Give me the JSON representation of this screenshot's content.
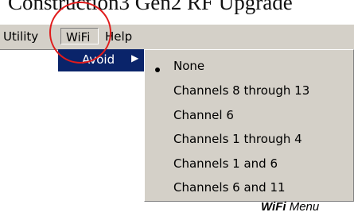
{
  "document": {
    "title": "Construction3 Gen2 RF Upgrade",
    "caption_bold": "WiFi",
    "caption_rest": " Menu"
  },
  "menubar": {
    "items": [
      {
        "label": "Utility"
      },
      {
        "label": "WiFi"
      },
      {
        "label": "Help"
      }
    ]
  },
  "submenu": {
    "label": "Avoid",
    "arrow": "▶"
  },
  "popup": {
    "selected_marker": "•",
    "options": [
      {
        "label": "None",
        "selected": true
      },
      {
        "label": "Channels 8 through 13",
        "selected": false
      },
      {
        "label": "Channel 6",
        "selected": false
      },
      {
        "label": "Channels 1 through 4",
        "selected": false
      },
      {
        "label": "Channels 1 and 6",
        "selected": false
      },
      {
        "label": "Channels 6 and 11",
        "selected": false
      }
    ]
  },
  "colors": {
    "menu_bg": "#d4d0c8",
    "highlight_bg": "#0a246a",
    "annotation": "#e01b1b"
  }
}
